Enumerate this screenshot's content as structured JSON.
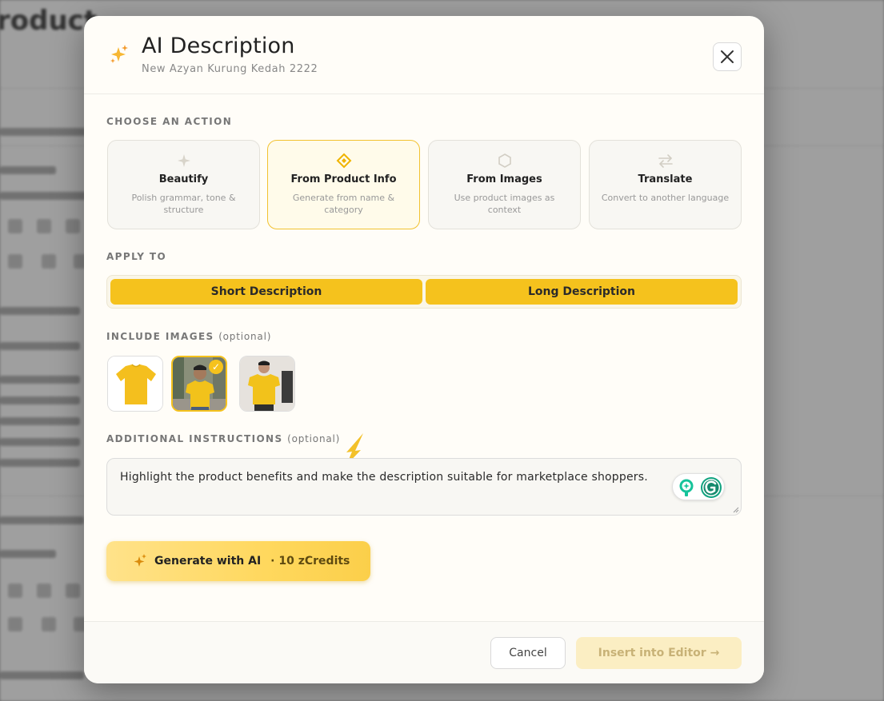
{
  "background": {
    "page_title": "roduct"
  },
  "modal": {
    "title": "AI Description",
    "subtitle": "New Azyan Kurung Kedah 2222",
    "header_icon": "sparkles-icon",
    "close_icon": "close-icon"
  },
  "choose_action": {
    "label": "CHOOSE AN ACTION",
    "selected": "from-product-info",
    "cards": [
      {
        "id": "beautify",
        "name": "Beautify",
        "desc": "Polish grammar, tone & structure",
        "icon": "sparkle-icon"
      },
      {
        "id": "from-product-info",
        "name": "From Product Info",
        "desc": "Generate from name & category",
        "icon": "diamond-icon"
      },
      {
        "id": "from-images",
        "name": "From Images",
        "desc": "Use product images as context",
        "icon": "hexagon-icon"
      },
      {
        "id": "translate",
        "name": "Translate",
        "desc": "Convert to another language",
        "icon": "arrows-swap-icon"
      }
    ]
  },
  "apply_to": {
    "label": "APPLY TO",
    "options": [
      "Short Description",
      "Long Description"
    ]
  },
  "include_images": {
    "label": "INCLUDE IMAGES",
    "optional": "(optional)",
    "thumbnails": [
      {
        "name": "yellow-tshirt-flat",
        "selected": false
      },
      {
        "name": "man-in-yellow-tshirt-street",
        "selected": true
      },
      {
        "name": "man-holding-yellow-tshirt",
        "selected": false
      }
    ],
    "check_mark": "✓"
  },
  "additional_instructions": {
    "label": "ADDITIONAL INSTRUCTIONS",
    "optional": "(optional)",
    "value": "Highlight the product benefits and make the description suitable for marketplace shoppers."
  },
  "generate": {
    "label": "Generate with AI",
    "credits": "· 10 zCredits",
    "icon": "sparkles-icon"
  },
  "footer": {
    "cancel": "Cancel",
    "insert": "Insert into Editor →"
  },
  "colors": {
    "accent": "#f5c21d",
    "accent_light": "#fffbea",
    "disabled_button": "#fbeec3"
  }
}
